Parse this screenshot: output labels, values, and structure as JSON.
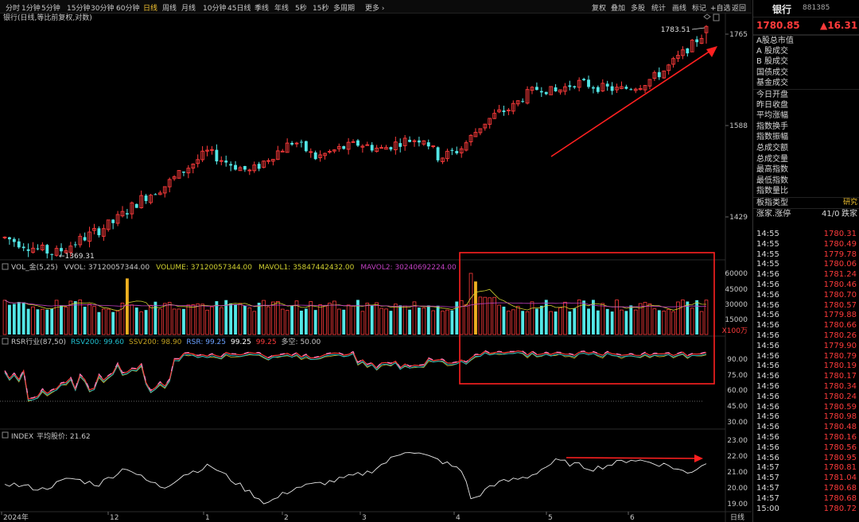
{
  "toolbar": {
    "timeframes": [
      "分时",
      "1分钟",
      "5分钟",
      "15分钟",
      "30分钟",
      "60分钟",
      "日线",
      "周线",
      "月线",
      "10分钟",
      "45日线",
      "季线",
      "年线",
      "5秒",
      "15秒",
      "多周期",
      "更多 ›"
    ],
    "active": "日线",
    "right_buttons": [
      "复权",
      "叠加",
      "多股",
      "统计",
      "画线",
      "标记",
      "+自选",
      "返回"
    ]
  },
  "main": {
    "title": "银行(日线,等比前复权,对数)",
    "price_axis": [
      "1765",
      "1588",
      "1429"
    ],
    "high_label": "1783.51",
    "low_label": "1369.31"
  },
  "volume": {
    "label_name": "VOL_金(5,25)",
    "label_vvol": "VVOL: 37120057344.00",
    "label_volume": "VOLUME: 37120057344.00",
    "label_mavol1": "MAVOL1: 35847442432.00",
    "label_mavol2": "MAVOL2: 30240692224.00",
    "axis": [
      "60000",
      "45000",
      "30000",
      "15000"
    ],
    "unit": "X100万"
  },
  "rsr": {
    "label_name": "RSR行业(87,50)",
    "label_rsv200": "RSV200: 99.60",
    "label_ssv200": "SSV200: 98.90",
    "label_rsr1": "RSR: 99.25",
    "label_rsr2": "99.25",
    "label_rsr3": "99.25",
    "label_duokong": "多空: 50.00",
    "axis": [
      "90.00",
      "75.00",
      "60.00",
      "45.00",
      "30.00"
    ]
  },
  "index": {
    "label_name": "INDEX",
    "label_avg": "平均股价: 21.62",
    "axis": [
      "23.00",
      "22.00",
      "21.00",
      "20.00",
      "19.00"
    ]
  },
  "dates": {
    "labels": [
      "2024年",
      "12",
      "1",
      "2",
      "3",
      "4",
      "5",
      "6"
    ],
    "period": "日线"
  },
  "panel": {
    "name": "银行",
    "code": "881385",
    "price": "1780.85",
    "change": "▲16.31",
    "fields_a": [
      "A股总市值",
      "A 股成交",
      "B 股成交",
      "国债成交",
      "基金成交"
    ],
    "fields_b": [
      "今日开盘",
      "昨日收盘",
      "平均涨幅",
      "指数换手",
      "指数振幅",
      "总成交额",
      "总成交量",
      "最高指数",
      "最低指数",
      "指数量比"
    ],
    "row_type_label": "板指类型",
    "row_type_value": "研究",
    "row_ud_label": "涨家.涨停",
    "row_ud_value": "41/0",
    "row_ud_value2": "跌家"
  },
  "ticks": [
    {
      "t": "14:55",
      "p": "1780.31"
    },
    {
      "t": "14:55",
      "p": "1780.49"
    },
    {
      "t": "14:55",
      "p": "1779.78"
    },
    {
      "t": "14:55",
      "p": "1780.06"
    },
    {
      "t": "14:56",
      "p": "1781.24"
    },
    {
      "t": "14:56",
      "p": "1780.46"
    },
    {
      "t": "14:56",
      "p": "1780.70"
    },
    {
      "t": "14:56",
      "p": "1780.57"
    },
    {
      "t": "14:56",
      "p": "1779.88"
    },
    {
      "t": "14:56",
      "p": "1780.66"
    },
    {
      "t": "14:56",
      "p": "1780.26"
    },
    {
      "t": "14:56",
      "p": "1779.90"
    },
    {
      "t": "14:56",
      "p": "1780.79"
    },
    {
      "t": "14:56",
      "p": "1780.19"
    },
    {
      "t": "14:56",
      "p": "1780.17"
    },
    {
      "t": "14:56",
      "p": "1780.34"
    },
    {
      "t": "14:56",
      "p": "1780.24"
    },
    {
      "t": "14:56",
      "p": "1780.59"
    },
    {
      "t": "14:56",
      "p": "1780.98"
    },
    {
      "t": "14:56",
      "p": "1780.48"
    },
    {
      "t": "14:56",
      "p": "1780.16"
    },
    {
      "t": "14:56",
      "p": "1780.56"
    },
    {
      "t": "14:56",
      "p": "1780.95"
    },
    {
      "t": "14:57",
      "p": "1780.81"
    },
    {
      "t": "14:57",
      "p": "1781.04"
    },
    {
      "t": "14:57",
      "p": "1780.68"
    },
    {
      "t": "14:57",
      "p": "1780.68"
    },
    {
      "t": "15:00",
      "p": "1780.72"
    }
  ],
  "colors": {
    "up": "#ff3b3b",
    "down": "#53e6e6",
    "volume_highlight": "#f0b020",
    "mavol1": "#d0d030",
    "mavol2": "#c040c0",
    "rsv200": "#20c0d0",
    "ssv200": "#c0a020",
    "rsr": "#ff80c0",
    "annotation": "#ff2020"
  }
}
